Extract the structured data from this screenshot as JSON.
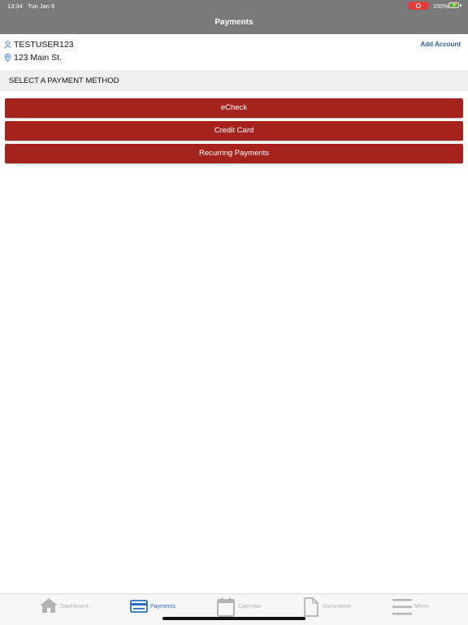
{
  "status_bar": {
    "time": "13:34",
    "date": "Tue Jan 9",
    "battery": "100%"
  },
  "nav": {
    "title": "Payments"
  },
  "account": {
    "username": "TESTUSER123",
    "address": "123 Main St.",
    "add_account_label": "Add Account"
  },
  "section": {
    "title": "SELECT A PAYMENT METHOD"
  },
  "payment_methods": [
    {
      "label": "eCheck"
    },
    {
      "label": "Credit Card"
    },
    {
      "label": "Recurring Payments"
    }
  ],
  "tabs": [
    {
      "label": "Dashboard",
      "icon": "home-icon"
    },
    {
      "label": "Payments",
      "icon": "credit-card-icon",
      "active": true
    },
    {
      "label": "Calendar",
      "icon": "calendar-icon"
    },
    {
      "label": "Documents",
      "icon": "document-icon"
    },
    {
      "label": "Menu",
      "icon": "menu-icon"
    }
  ],
  "colors": {
    "nav_bg": "#7a7a7a",
    "button_bg": "#a6221d",
    "link": "#2b5c8f",
    "tab_active": "#2a6fc4",
    "tab_inactive": "#b3b3b3"
  }
}
